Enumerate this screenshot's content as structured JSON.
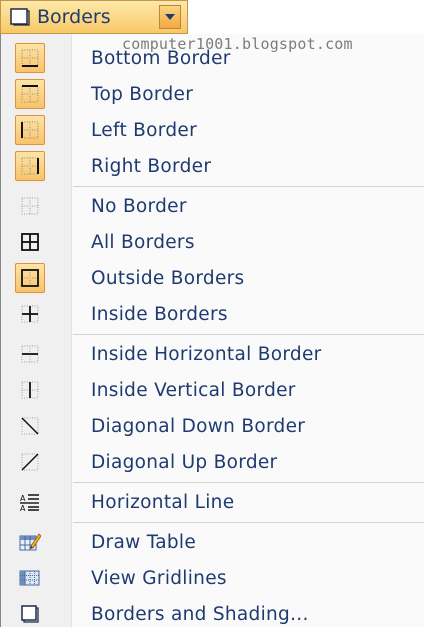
{
  "top_button": {
    "label": "Borders",
    "icon": "borders-and-shading-icon"
  },
  "watermark": "computer1001.blogspot.com",
  "menu": {
    "items": [
      {
        "label": "Bottom Border",
        "icon": "bottom-border-icon",
        "checked": true
      },
      {
        "label": "Top Border",
        "icon": "top-border-icon",
        "checked": true
      },
      {
        "label": "Left Border",
        "icon": "left-border-icon",
        "checked": true
      },
      {
        "label": "Right Border",
        "icon": "right-border-icon",
        "checked": true
      },
      {
        "label": "No Border",
        "icon": "no-border-icon",
        "checked": false
      },
      {
        "label": "All Borders",
        "icon": "all-borders-icon",
        "checked": false
      },
      {
        "label": "Outside Borders",
        "icon": "outside-borders-icon",
        "checked": true
      },
      {
        "label": "Inside Borders",
        "icon": "inside-borders-icon",
        "checked": false
      },
      {
        "label": "Inside Horizontal Border",
        "icon": "inside-horizontal-border-icon",
        "checked": false
      },
      {
        "label": "Inside Vertical Border",
        "icon": "inside-vertical-border-icon",
        "checked": false
      },
      {
        "label": "Diagonal Down Border",
        "icon": "diagonal-down-border-icon",
        "checked": false
      },
      {
        "label": "Diagonal Up Border",
        "icon": "diagonal-up-border-icon",
        "checked": false
      },
      {
        "label": "Horizontal Line",
        "icon": "horizontal-line-icon",
        "checked": false
      },
      {
        "label": "Draw Table",
        "icon": "draw-table-icon",
        "checked": false
      },
      {
        "label": "View Gridlines",
        "icon": "view-gridlines-icon",
        "checked": false
      },
      {
        "label": "Borders and Shading...",
        "icon": "borders-and-shading-icon",
        "checked": false
      }
    ]
  },
  "colors": {
    "text": "#1f3a70",
    "checked_bg": "#f8c36a",
    "checked_border": "#e0913b"
  }
}
